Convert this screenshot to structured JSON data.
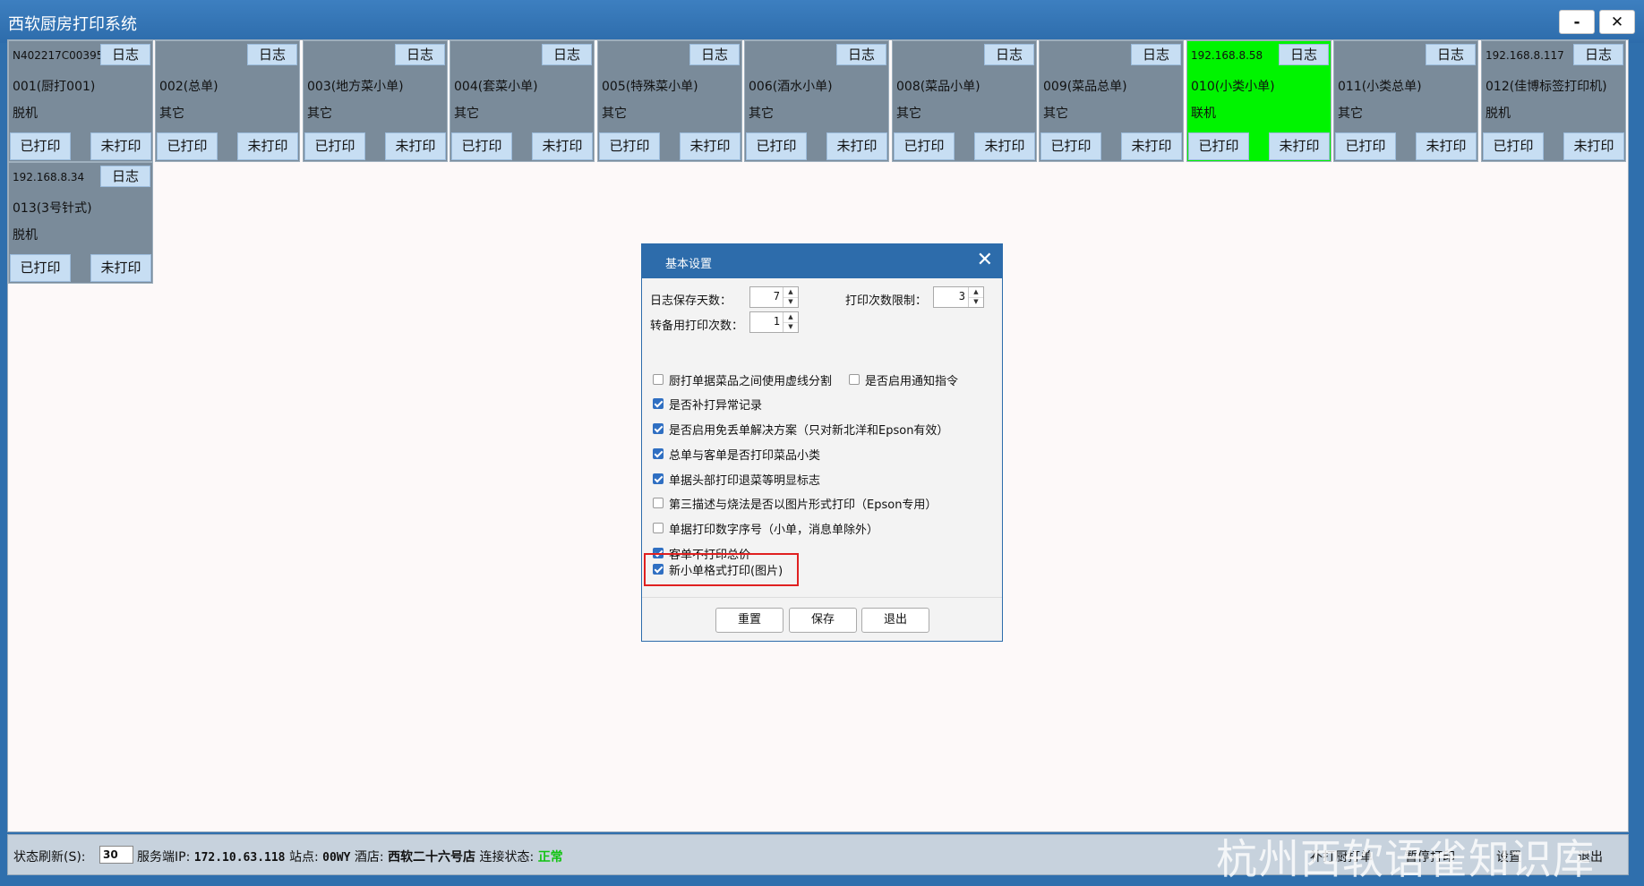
{
  "window": {
    "title": "西软厨房打印系统",
    "minimize": "-",
    "close": "✕"
  },
  "printers": [
    {
      "ip": "N402217C00395",
      "log": "日志",
      "name": "001(厨打001)",
      "status": "脱机",
      "printed": "已打印",
      "unprinted": "未打印",
      "online": false
    },
    {
      "ip": "",
      "log": "日志",
      "name": "002(总单)",
      "status": "其它",
      "printed": "已打印",
      "unprinted": "未打印",
      "online": false
    },
    {
      "ip": "",
      "log": "日志",
      "name": "003(地方菜小单)",
      "status": "其它",
      "printed": "已打印",
      "unprinted": "未打印",
      "online": false
    },
    {
      "ip": "",
      "log": "日志",
      "name": "004(套菜小单)",
      "status": "其它",
      "printed": "已打印",
      "unprinted": "未打印",
      "online": false
    },
    {
      "ip": "",
      "log": "日志",
      "name": "005(特殊菜小单)",
      "status": "其它",
      "printed": "已打印",
      "unprinted": "未打印",
      "online": false
    },
    {
      "ip": "",
      "log": "日志",
      "name": "006(酒水小单)",
      "status": "其它",
      "printed": "已打印",
      "unprinted": "未打印",
      "online": false
    },
    {
      "ip": "",
      "log": "日志",
      "name": "008(菜品小单)",
      "status": "其它",
      "printed": "已打印",
      "unprinted": "未打印",
      "online": false
    },
    {
      "ip": "",
      "log": "日志",
      "name": "009(菜品总单)",
      "status": "其它",
      "printed": "已打印",
      "unprinted": "未打印",
      "online": false
    },
    {
      "ip": "192.168.8.58",
      "log": "日志",
      "name": "010(小类小单)",
      "status": "联机",
      "printed": "已打印",
      "unprinted": "未打印",
      "online": true
    },
    {
      "ip": "",
      "log": "日志",
      "name": "011(小类总单)",
      "status": "其它",
      "printed": "已打印",
      "unprinted": "未打印",
      "online": false
    },
    {
      "ip": "192.168.8.117",
      "log": "日志",
      "name": "012(佳博标签打印机)",
      "status": "脱机",
      "printed": "已打印",
      "unprinted": "未打印",
      "online": false
    },
    {
      "ip": "192.168.8.34",
      "log": "日志",
      "name": "013(3号针式)",
      "status": "脱机",
      "printed": "已打印",
      "unprinted": "未打印",
      "online": false
    }
  ],
  "dialog": {
    "title": "基本设置",
    "close": "✕",
    "fields": {
      "log_days_label": "日志保存天数：",
      "log_days_value": "7",
      "print_limit_label": "打印次数限制：",
      "print_limit_value": "3",
      "backup_label": "转备用打印次数：",
      "backup_value": "1"
    },
    "options": [
      {
        "label": "厨打单据菜品之间使用虚线分割",
        "checked": false
      },
      {
        "label": "是否启用通知指令",
        "checked": false
      },
      {
        "label": "是否补打异常记录",
        "checked": true
      },
      {
        "label": "是否启用免丢单解决方案（只对新北洋和Epson有效）",
        "checked": true
      },
      {
        "label": "总单与客单是否打印菜品小类",
        "checked": true
      },
      {
        "label": "单据头部打印退菜等明显标志",
        "checked": true
      },
      {
        "label": "第三描述与烧法是否以图片形式打印（Epson专用）",
        "checked": false
      },
      {
        "label": "单据打印数字序号（小单，消息单除外）",
        "checked": false
      },
      {
        "label": "客单不打印总价",
        "checked": true
      },
      {
        "label": "新小单格式打印(图片)",
        "checked": true
      }
    ],
    "buttons": {
      "reset": "重置",
      "save": "保存",
      "exit": "退出"
    }
  },
  "statusbar": {
    "refresh_label": "状态刷新(S):",
    "refresh_value": "30",
    "server_ip_label": "服务端IP:",
    "server_ip": "172.10.63.118",
    "site_label": "站点:",
    "site": "00WY",
    "hotel_label": "酒店:",
    "hotel": "西软二十六号店",
    "conn_label": "连接状态:",
    "conn": "正常",
    "right_1": "补打厨打单",
    "right_2": "暂停打印",
    "right_3": "设置",
    "right_4": "退出"
  },
  "watermark": "杭州西软语雀知识库"
}
